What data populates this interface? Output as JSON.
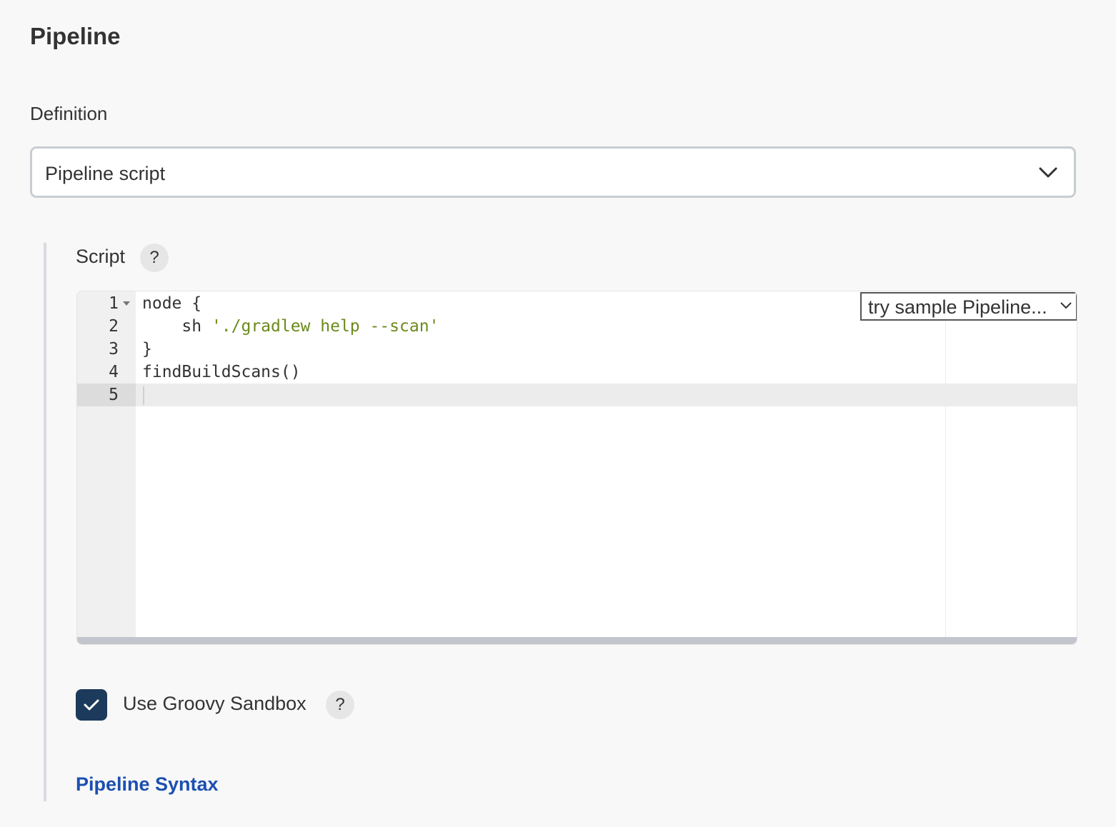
{
  "section": {
    "title": "Pipeline"
  },
  "definition": {
    "label": "Definition",
    "selected": "Pipeline script"
  },
  "script": {
    "label": "Script",
    "help": "?",
    "sample_select": "try sample Pipeline...",
    "lines": [
      {
        "num": "1",
        "code_plain": "node {",
        "fold": true
      },
      {
        "num": "2",
        "code_plain": "    sh ",
        "code_string": "'./gradlew help --scan'"
      },
      {
        "num": "3",
        "code_plain": "}"
      },
      {
        "num": "4",
        "code_plain": "findBuildScans()"
      },
      {
        "num": "5",
        "code_plain": ""
      }
    ]
  },
  "sandbox": {
    "label": "Use Groovy Sandbox",
    "checked": true,
    "help": "?"
  },
  "links": {
    "pipeline_syntax": "Pipeline Syntax"
  },
  "colors": {
    "accent_checkbox": "#1c3a5c",
    "link": "#1c4fb0",
    "string": "#6b8a1c"
  },
  "icons": {
    "dropdown": "chevron-down-icon",
    "help": "question-icon",
    "check": "check-icon"
  }
}
